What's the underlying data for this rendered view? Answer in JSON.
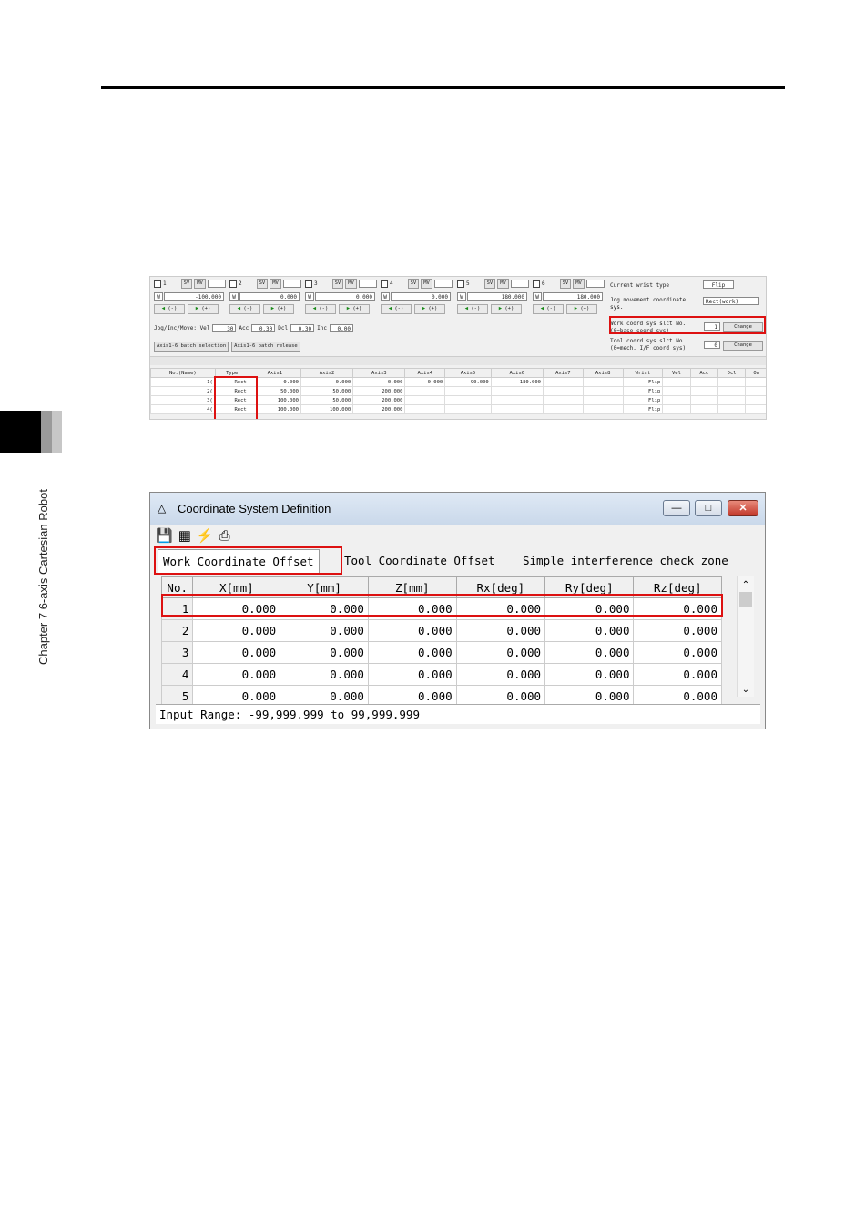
{
  "sidebar": {
    "chapter_label": "Chapter 7 6-axis Cartesian Robot"
  },
  "figure1": {
    "axes": [
      {
        "num": "1",
        "value": "-100.000"
      },
      {
        "num": "2",
        "value": "0.000"
      },
      {
        "num": "3",
        "value": "0.000"
      },
      {
        "num": "4",
        "value": "0.000"
      },
      {
        "num": "5",
        "value": "180.000"
      },
      {
        "num": "6",
        "value": "180.000"
      }
    ],
    "sv_label": "SV",
    "mv_label": "MV",
    "w_label": "W",
    "jog_minus": "(-)",
    "jog_plus": "(+)",
    "jog_label": "Jog/Inc/Move: Vel",
    "vel": "30",
    "acc_label": "Acc",
    "acc": "0.30",
    "dcl_label": "Dcl",
    "dcl": "0.30",
    "inc_label": "Inc",
    "inc": "0.00",
    "batch_select": "Axis1-6 batch selection",
    "batch_release": "Axis1-6 batch release",
    "wrist_label": "Current wrist type",
    "wrist_value": "Flip",
    "jog_coord_label": "Jog movement coordinate sys.",
    "jog_coord_value": "Rect(work)",
    "work_coord_label": "Work coord sys slct No. (0=base coord sys)",
    "work_coord_value": "1",
    "tool_coord_label": "Tool coord sys slct No. (0=mech. I/F coord sys)",
    "tool_coord_value": "0",
    "change_label": "Change",
    "columns": [
      "No.(Name)",
      "Type",
      "Axis1",
      "Axis2",
      "Axis3",
      "Axis4",
      "Axis5",
      "Axis6",
      "Axis7",
      "Axis8",
      "Wrist",
      "Vel",
      "Acc",
      "Dcl",
      "Ou"
    ],
    "rows": [
      [
        "1(",
        "Rect",
        "0.000",
        "0.000",
        "0.000",
        "0.000",
        "90.000",
        "180.000",
        "",
        "",
        "Flip",
        "",
        "",
        "",
        ""
      ],
      [
        "2(",
        "Rect",
        "50.000",
        "50.000",
        "200.000",
        "",
        "",
        "",
        "",
        "",
        "Flip",
        "",
        "",
        "",
        ""
      ],
      [
        "3(",
        "Rect",
        "100.000",
        "50.000",
        "200.000",
        "",
        "",
        "",
        "",
        "",
        "Flip",
        "",
        "",
        "",
        ""
      ],
      [
        "4(",
        "Rect",
        "100.000",
        "100.000",
        "200.000",
        "",
        "",
        "",
        "",
        "",
        "Flip",
        "",
        "",
        "",
        ""
      ]
    ]
  },
  "figure2": {
    "title": "Coordinate System Definition",
    "tabs": [
      "Work Coordinate Offset",
      "Tool Coordinate Offset",
      "Simple interference check zone"
    ],
    "columns": [
      "No.",
      "X[mm]",
      "Y[mm]",
      "Z[mm]",
      "Rx[deg]",
      "Ry[deg]",
      "Rz[deg]"
    ],
    "rows": [
      [
        "1",
        "0.000",
        "0.000",
        "0.000",
        "0.000",
        "0.000",
        "0.000"
      ],
      [
        "2",
        "0.000",
        "0.000",
        "0.000",
        "0.000",
        "0.000",
        "0.000"
      ],
      [
        "3",
        "0.000",
        "0.000",
        "0.000",
        "0.000",
        "0.000",
        "0.000"
      ],
      [
        "4",
        "0.000",
        "0.000",
        "0.000",
        "0.000",
        "0.000",
        "0.000"
      ],
      [
        "5",
        "0.000",
        "0.000",
        "0.000",
        "0.000",
        "0.000",
        "0.000"
      ]
    ],
    "status": "Input Range: -99,999.999 to 99,999.999"
  }
}
